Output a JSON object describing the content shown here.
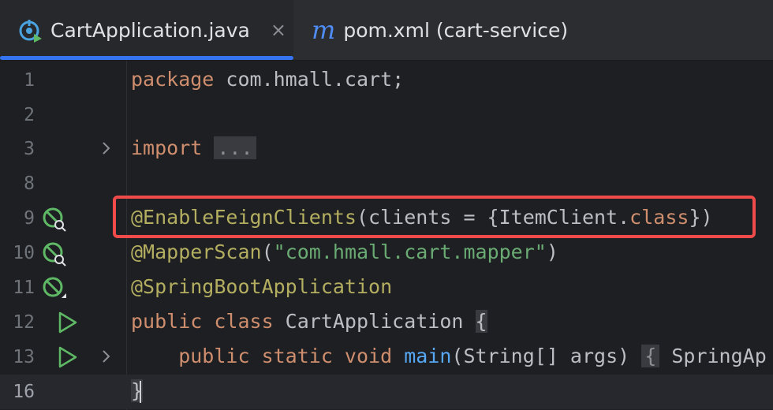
{
  "tabs": [
    {
      "title": "CartApplication.java",
      "icon": "spring-run-icon",
      "active": true
    },
    {
      "title": "pom.xml (cart-service)",
      "icon": "maven-m-icon",
      "active": false
    }
  ],
  "close_glyph": "×",
  "maven_glyph": "m",
  "lines": [
    {
      "num": "1"
    },
    {
      "num": "2"
    },
    {
      "num": "3"
    },
    {
      "num": "8"
    },
    {
      "num": "9"
    },
    {
      "num": "10"
    },
    {
      "num": "11"
    },
    {
      "num": "12"
    },
    {
      "num": "13"
    },
    {
      "num": "16"
    }
  ],
  "code": {
    "l1_kw": "package",
    "l1_rest": " com.hmall.cart;",
    "l3_kw": "import",
    "l3_fold": "...",
    "l9_ann": "@EnableFeignClients",
    "l9_a": "(clients = {ItemClient.",
    "l9_kw": "class",
    "l9_b": "})",
    "l10_ann": "@MapperScan",
    "l10_a": "(",
    "l10_str": "\"com.hmall.cart.mapper\"",
    "l10_b": ")",
    "l11_ann": "@SpringBootApplication",
    "l12_kw": "public class",
    "l12_rest": " CartApplication ",
    "l12_brace": "{",
    "l13_kw": "    public static void",
    "l13_fn": " main",
    "l13_rest": "(String[] args) ",
    "l13_brace": "{",
    "l13_tail": " SpringAp",
    "l16_brace": "}"
  },
  "colors": {
    "accent": "#3574f0",
    "highlight": "#ef4b4b",
    "keyword": "#cf8e6d",
    "annotation": "#b3ae60",
    "string": "#6aab73",
    "function": "#56a8f5"
  }
}
